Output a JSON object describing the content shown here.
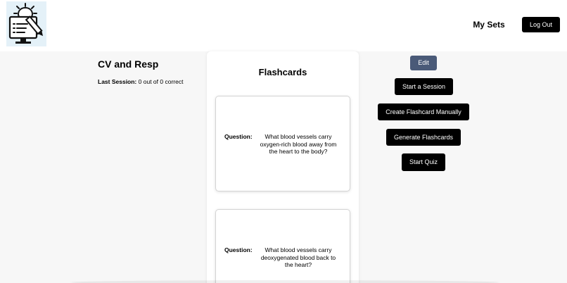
{
  "header": {
    "logo_icon": "lightbulb-monitor-pencil-icon",
    "my_sets_label": "My Sets",
    "logout_label": "Log Out"
  },
  "set": {
    "title": "CV and Resp",
    "last_session_label": "Last Session:",
    "last_session_value": "0 out of 0 correct"
  },
  "flashcards": {
    "title": "Flashcards",
    "cards": [
      {
        "question_label": "Question:",
        "question_text": "What blood vessels carry oxygen-rich blood away from the heart to the body?"
      },
      {
        "question_label": "Question:",
        "question_text": "What blood vessels carry deoxygenated blood back to the heart?"
      }
    ]
  },
  "actions": {
    "edit_label": "Edit",
    "start_session_label": "Start a Session",
    "create_manual_label": "Create Flashcard Manually",
    "generate_label": "Generate Flashcards",
    "start_quiz_label": "Start Quiz"
  },
  "colors": {
    "edit_button": "#4a5a78",
    "primary_button": "#000000",
    "page_background": "#f7f7f7"
  }
}
